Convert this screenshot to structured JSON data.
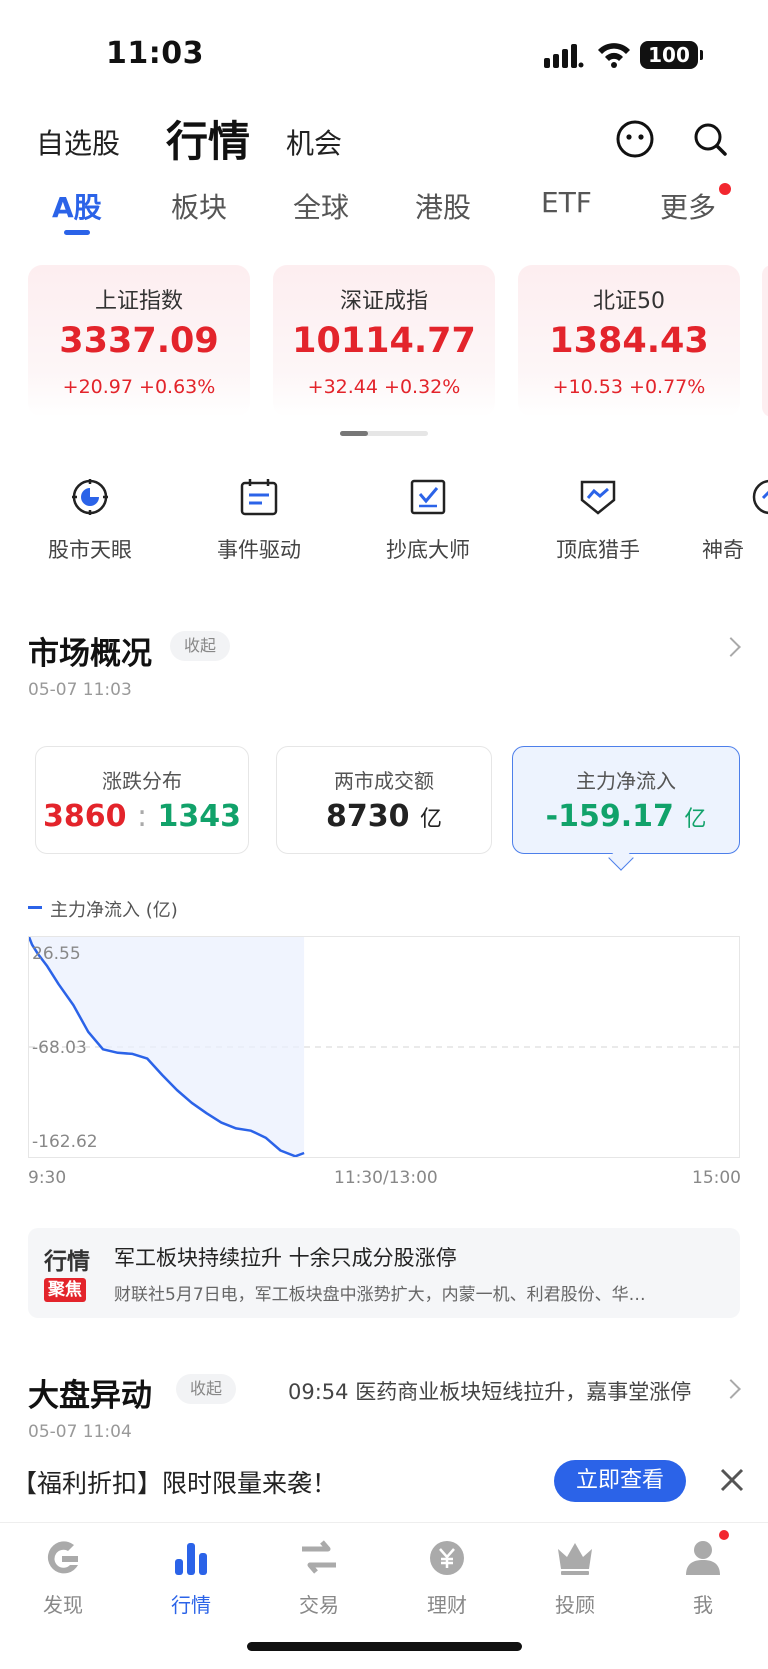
{
  "status_bar": {
    "time": "11:03",
    "battery": "100"
  },
  "header": {
    "tabs": [
      {
        "label": "自选股"
      },
      {
        "label": "行情",
        "active": true
      },
      {
        "label": "机会"
      }
    ],
    "icons": [
      "face-icon",
      "search-icon"
    ]
  },
  "market_tabs": [
    {
      "label": "A股",
      "active": true
    },
    {
      "label": "板块"
    },
    {
      "label": "全球"
    },
    {
      "label": "港股"
    },
    {
      "label": "ETF"
    },
    {
      "label": "更多",
      "badge": true
    }
  ],
  "indices": [
    {
      "name": "上证指数",
      "value": "3337.09",
      "change": "+20.97 +0.63%"
    },
    {
      "name": "深证成指",
      "value": "10114.77",
      "change": "+32.44 +0.32%"
    },
    {
      "name": "北证50",
      "value": "1384.43",
      "change": "+10.53 +0.77%"
    }
  ],
  "tools": [
    {
      "label": "股市天眼",
      "icon": "eye-target-icon"
    },
    {
      "label": "事件驱动",
      "icon": "calendar-event-icon"
    },
    {
      "label": "抄底大师",
      "icon": "bottom-fishing-icon"
    },
    {
      "label": "顶底猎手",
      "icon": "shield-chart-icon"
    },
    {
      "label": "神奇",
      "icon": "magic-icon"
    }
  ],
  "market_overview": {
    "title": "市场概况",
    "collapse_label": "收起",
    "time": "05-07 11:03",
    "stats": [
      {
        "label": "涨跌分布",
        "up": "3860",
        "sep": ":",
        "down": "1343"
      },
      {
        "label": "两市成交额",
        "value": "8730",
        "unit": "亿"
      },
      {
        "label": "主力净流入",
        "value": "-159.17",
        "unit": "亿",
        "selected": true
      }
    ]
  },
  "chart_data": {
    "type": "line",
    "legend": "主力净流入 (亿)",
    "series": [
      {
        "name": "主力净流入 (亿)",
        "x": [
          "09:30",
          "09:31",
          "09:33",
          "09:36",
          "09:40",
          "09:45",
          "09:50",
          "09:55",
          "10:00",
          "10:05",
          "10:10",
          "10:15",
          "10:20",
          "10:25",
          "10:30",
          "10:35",
          "10:40",
          "10:45",
          "10:50",
          "10:55",
          "11:00",
          "11:03"
        ],
        "values": [
          26.6,
          20.0,
          12.0,
          2.0,
          -14.0,
          -32.0,
          -55.0,
          -70.0,
          -73.0,
          -74.0,
          -78.0,
          -92.0,
          -105.0,
          -116.0,
          -125.0,
          -133.0,
          -138.0,
          -140.0,
          -146.0,
          -157.0,
          -162.0,
          -159.17
        ]
      }
    ],
    "ylim": [
      -162.62,
      26.55
    ],
    "yticks": [
      "26.55",
      "-68.03",
      "-162.62"
    ],
    "xticks": [
      "9:30",
      "11:30/13:00",
      "15:00"
    ],
    "reference_line": -68.03,
    "color": "#2b63e8"
  },
  "news": {
    "logo_line1": "行情",
    "logo_line2": "聚焦",
    "title": "军工板块持续拉升 十余只成分股涨停",
    "summary": "财联社5月7日电，军工板块盘中涨势扩大，内蒙一机、利君股份、华…"
  },
  "market_movement": {
    "title": "大盘异动",
    "collapse_label": "收起",
    "time": "05-07 11:04",
    "headline": "09:54 医药商业板块短线拉升，嘉事堂涨停"
  },
  "promo": {
    "text": "【福利折扣】限时限量来袭！",
    "button": "立即查看"
  },
  "bottom_nav": [
    {
      "label": "发现",
      "icon": "discover-icon"
    },
    {
      "label": "行情",
      "icon": "market-chart-icon",
      "active": true
    },
    {
      "label": "交易",
      "icon": "trade-arrows-icon"
    },
    {
      "label": "理财",
      "icon": "wealth-coin-icon"
    },
    {
      "label": "投顾",
      "icon": "advisor-crown-icon"
    },
    {
      "label": "我",
      "icon": "profile-icon",
      "badge": true
    }
  ],
  "colors": {
    "accent": "#2b63e8",
    "up": "#e3242b",
    "down": "#11a26a"
  }
}
